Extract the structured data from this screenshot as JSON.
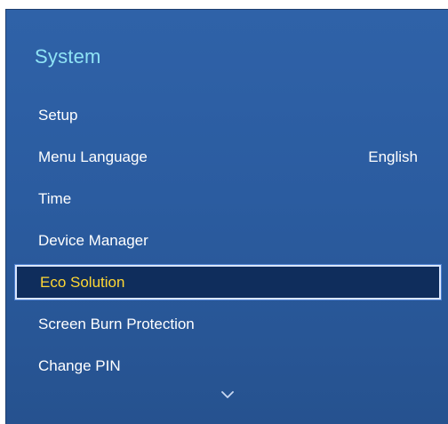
{
  "menu": {
    "title": "System",
    "items": [
      {
        "label": "Setup",
        "value": ""
      },
      {
        "label": "Menu Language",
        "value": "English"
      },
      {
        "label": "Time",
        "value": ""
      },
      {
        "label": "Device Manager",
        "value": ""
      },
      {
        "label": "Eco Solution",
        "value": "",
        "selected": true
      },
      {
        "label": "Screen Burn Protection",
        "value": ""
      },
      {
        "label": "Change PIN",
        "value": ""
      }
    ],
    "scroll_icon": "chevron-down-icon"
  },
  "colors": {
    "panel_bg": "#2b5ca0",
    "title": "#8fe3f5",
    "text": "#ffffff",
    "selected_text": "#ffd733",
    "selected_bg": "#0f2d5c"
  }
}
